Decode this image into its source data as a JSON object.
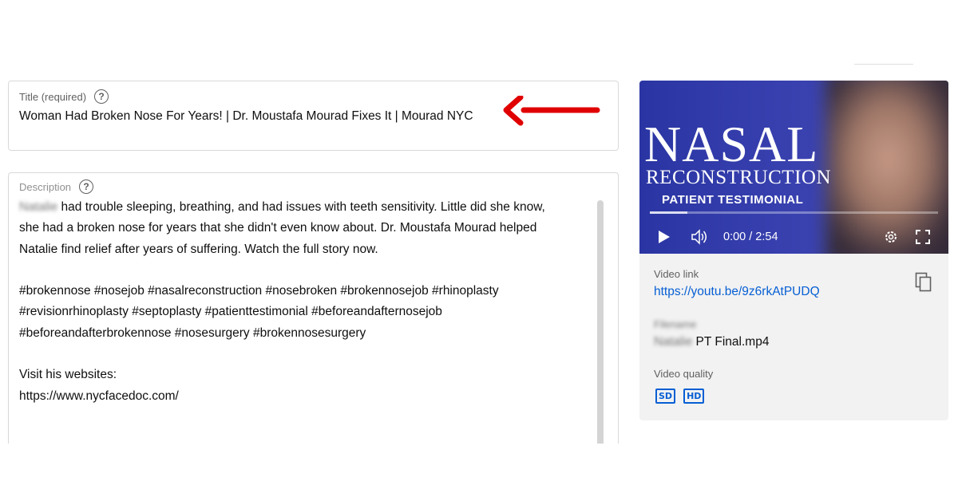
{
  "title_field": {
    "label": "Title (required)",
    "help": "?",
    "value": "Woman Had Broken Nose For Years! | Dr. Moustafa Mourad Fixes It | Mourad NYC"
  },
  "description_field": {
    "label": "Description",
    "help": "?",
    "line1_name": "Natalie",
    "line1_rest": " had trouble sleeping, breathing, and had issues with teeth sensitivity. Little did she know,",
    "line2": "she had a broken nose for years that she didn't even know about. Dr. Moustafa Mourad helped",
    "line3": "Natalie find relief after years of suffering. Watch the full story now.",
    "line5": "#brokennose #nosejob #nasalreconstruction #nosebroken #brokennosejob #rhinoplasty",
    "line6": "#revisionrhinoplasty #septoplasty #patienttestimonial #beforeandafternosejob",
    "line7": "#beforeandafterbrokennose #nosesurgery #brokennosesurgery",
    "line9": "Visit his websites:",
    "line10": "https://www.nycfacedoc.com/"
  },
  "video": {
    "thumb_title": "NASAL",
    "thumb_subtitle": "RECONSTRUCTION",
    "thumb_tag": "PATIENT TESTIMONIAL",
    "time": "0:00 / 2:54",
    "progress": 0.13
  },
  "details": {
    "link_label": "Video link",
    "link_value": "https://youtu.be/9z6rkAtPUDQ",
    "filename_label": "Filename",
    "filename_name": "Natalie",
    "filename_rest": " PT Final.mp4",
    "quality_label": "Video quality",
    "quality_badges": [
      "SD",
      "HD"
    ]
  },
  "colors": {
    "accent": "#065fd4",
    "arrow": "#e00000"
  }
}
